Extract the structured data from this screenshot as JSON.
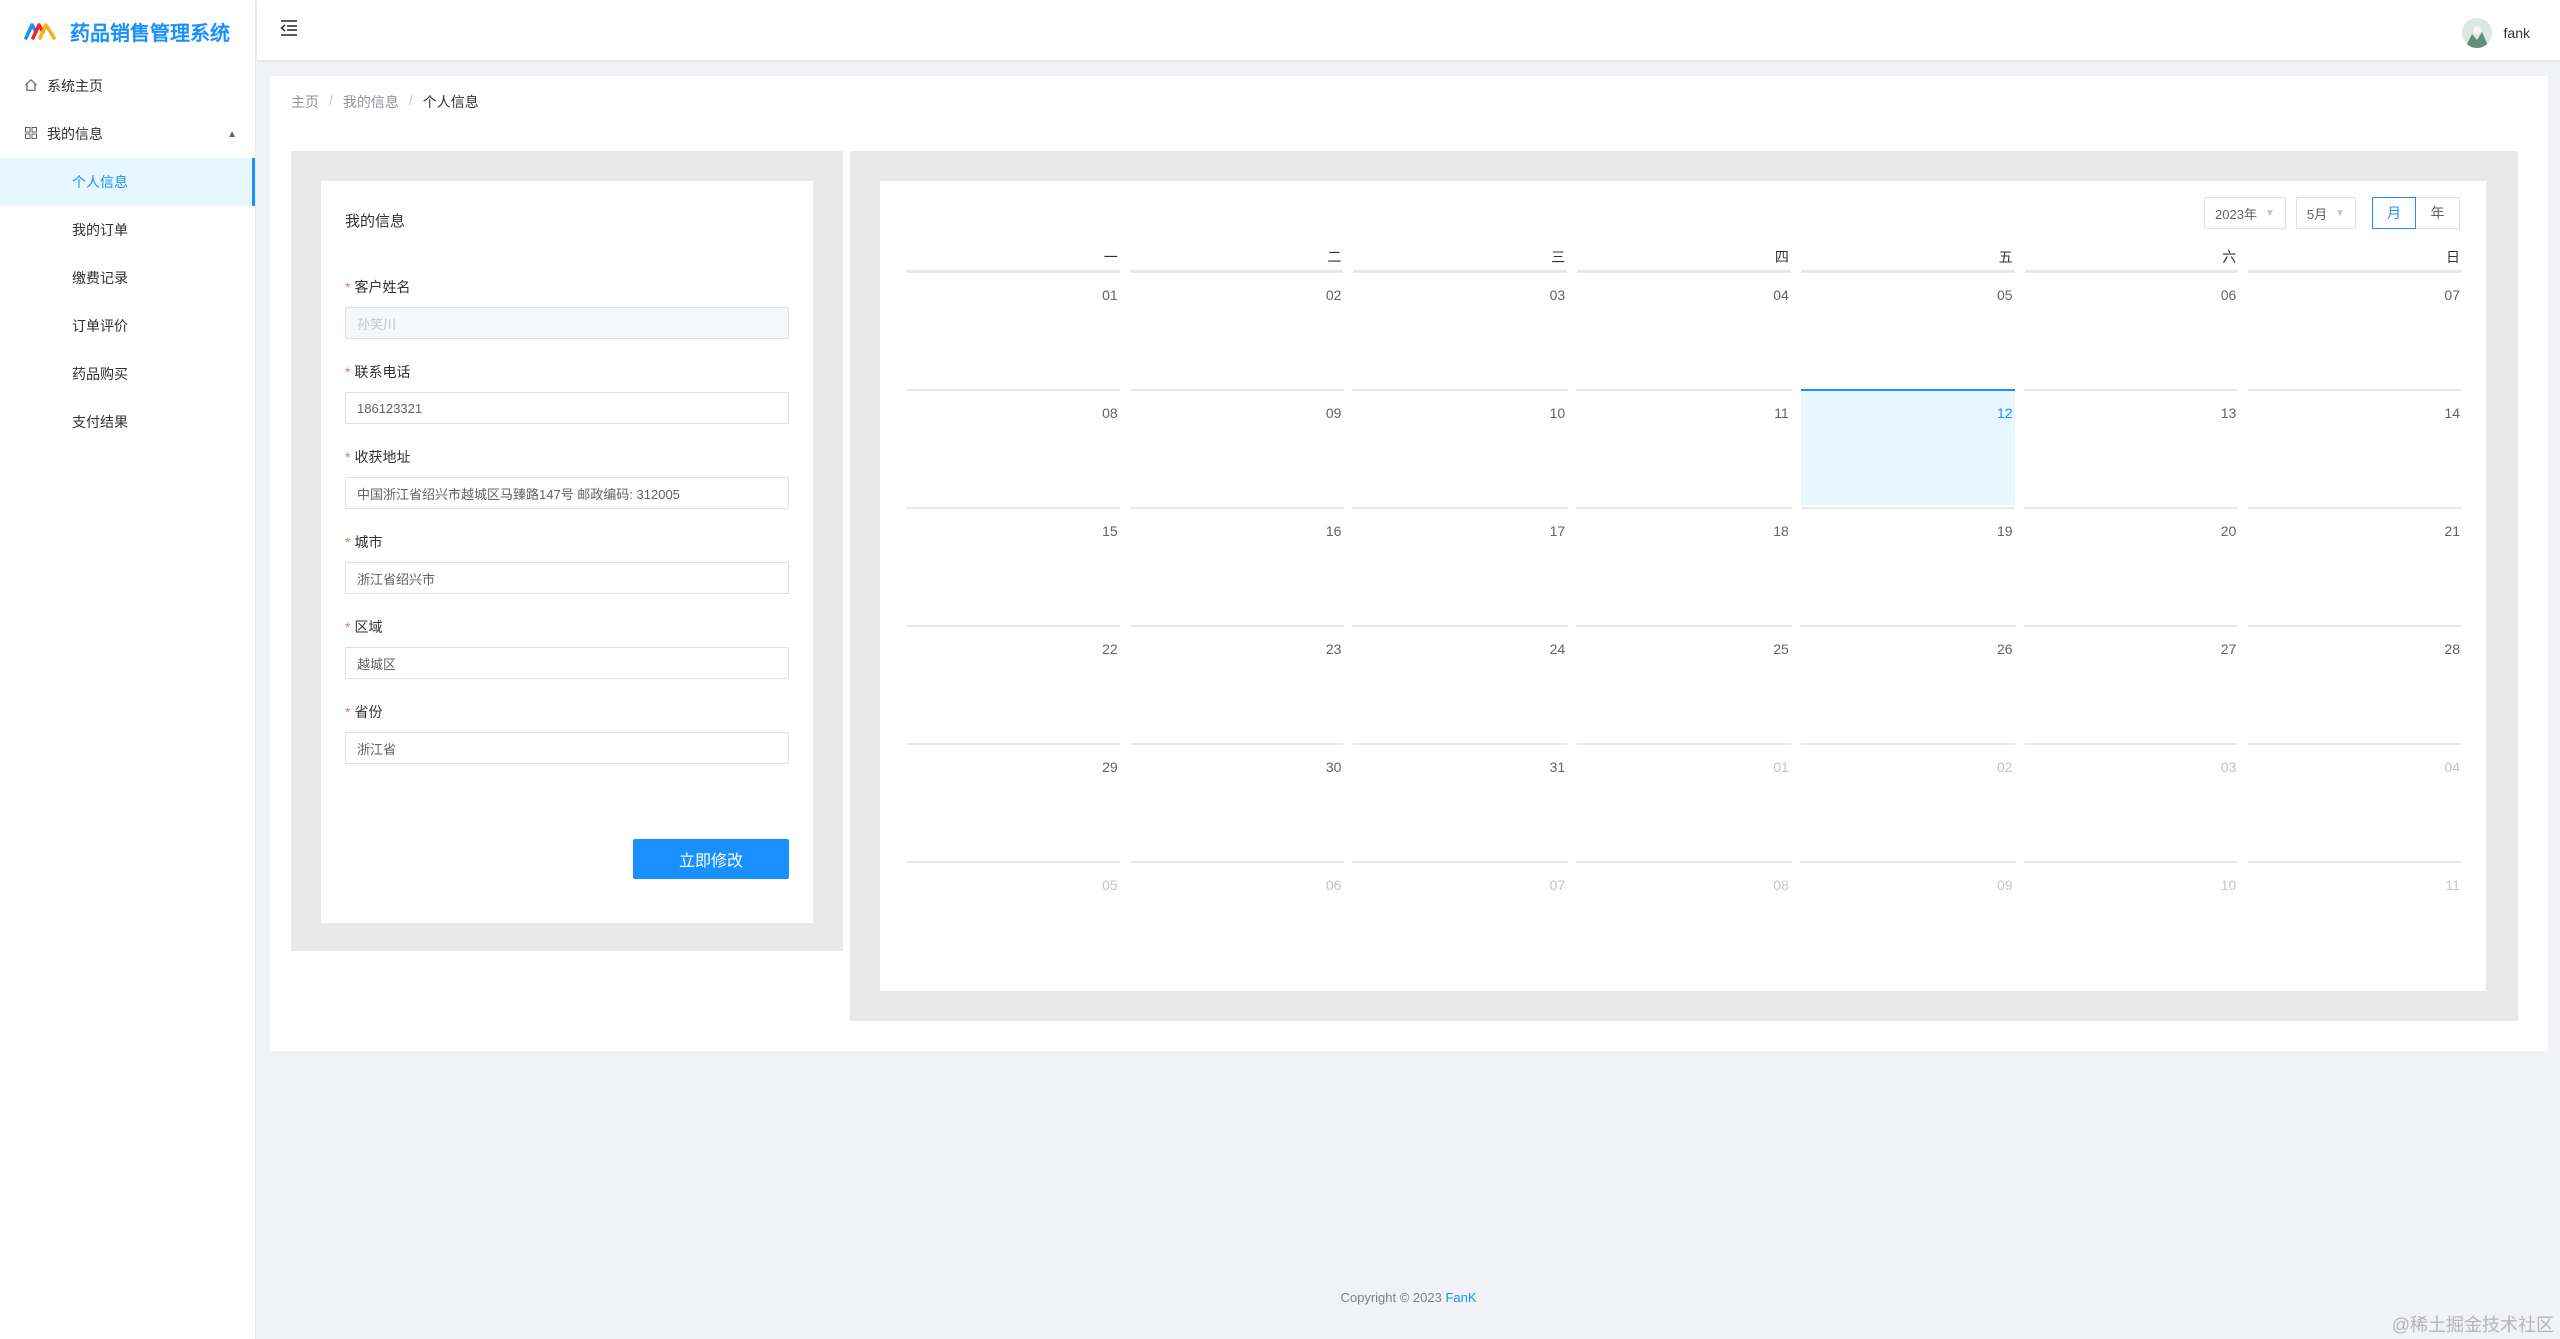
{
  "app": {
    "title": "药品销售管理系统",
    "accent": "#1890ff"
  },
  "sidebar": {
    "items": [
      {
        "label": "系统主页",
        "icon": "home-icon"
      },
      {
        "label": "我的信息",
        "icon": "grid-icon",
        "expanded": true
      },
      {
        "label": "个人信息",
        "active": true
      },
      {
        "label": "我的订单"
      },
      {
        "label": "缴费记录"
      },
      {
        "label": "订单评价"
      },
      {
        "label": "药品购买"
      },
      {
        "label": "支付结果"
      }
    ]
  },
  "header": {
    "user_name": "fank"
  },
  "breadcrumb": [
    "主页",
    "我的信息",
    "个人信息"
  ],
  "form": {
    "title": "我的信息",
    "fields": [
      {
        "label": "客户姓名",
        "value": "孙笑川",
        "disabled": true
      },
      {
        "label": "联系电话",
        "value": "186123321"
      },
      {
        "label": "收获地址",
        "value": "中国浙江省绍兴市越城区马臻路147号 邮政编码: 312005"
      },
      {
        "label": "城市",
        "value": "浙江省绍兴市"
      },
      {
        "label": "区域",
        "value": "越城区"
      },
      {
        "label": "省份",
        "value": "浙江省"
      }
    ],
    "submit_label": "立即修改"
  },
  "calendar": {
    "year_select": "2023年",
    "month_select": "5月",
    "mode_month": "月",
    "mode_year": "年",
    "weekdays": [
      "一",
      "二",
      "三",
      "四",
      "五",
      "六",
      "日"
    ],
    "weeks": [
      [
        "01",
        "02",
        "03",
        "04",
        "05",
        "06",
        "07"
      ],
      [
        "08",
        "09",
        "10",
        "11",
        "12",
        "13",
        "14"
      ],
      [
        "15",
        "16",
        "17",
        "18",
        "19",
        "20",
        "21"
      ],
      [
        "22",
        "23",
        "24",
        "25",
        "26",
        "27",
        "28"
      ],
      [
        "29",
        "30",
        "31",
        "01",
        "02",
        "03",
        "04"
      ],
      [
        "05",
        "06",
        "07",
        "08",
        "09",
        "10",
        "11"
      ]
    ],
    "today": "12"
  },
  "footer": {
    "copyright": "Copyright © 2023 ",
    "brand": "FanK"
  },
  "watermark": "@稀土掘金技术社区"
}
